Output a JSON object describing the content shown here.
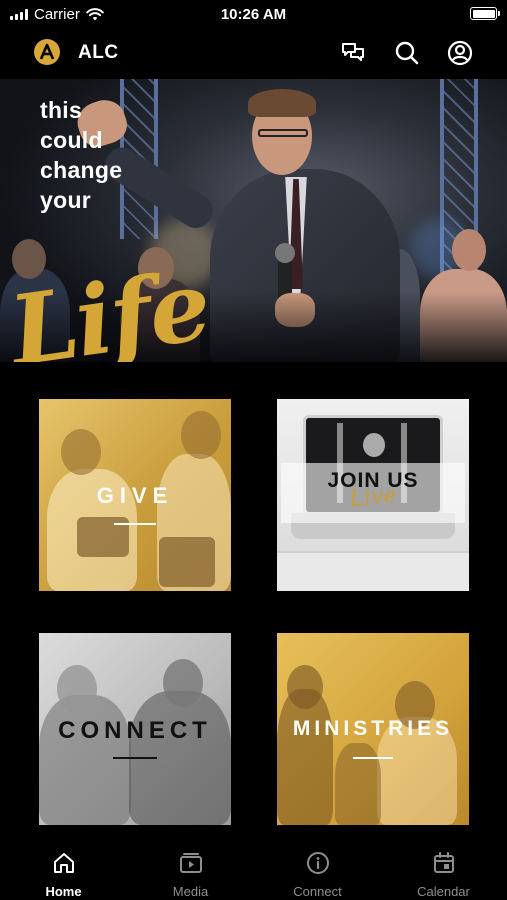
{
  "status_bar": {
    "carrier": "Carrier",
    "time": "10:26 AM"
  },
  "app_bar": {
    "title": "ALC",
    "logo_letter": "A"
  },
  "hero": {
    "headline_lines": [
      "this",
      "could",
      "change",
      "your"
    ],
    "script_word": "Life"
  },
  "tiles": {
    "give": {
      "label": "GIVE"
    },
    "join": {
      "label_main": "JOIN US",
      "label_script": "Live"
    },
    "connect": {
      "label": "CONNECT"
    },
    "ministries": {
      "label": "MINISTRIES"
    }
  },
  "tab_bar": {
    "tabs": [
      {
        "label": "Home",
        "icon": "home-icon",
        "active": true
      },
      {
        "label": "Media",
        "icon": "play-icon",
        "active": false
      },
      {
        "label": "Connect",
        "icon": "info-icon",
        "active": false
      },
      {
        "label": "Calendar",
        "icon": "calendar-icon",
        "active": false
      }
    ]
  },
  "colors": {
    "accent_gold": "#d3a637",
    "background": "#000000"
  }
}
